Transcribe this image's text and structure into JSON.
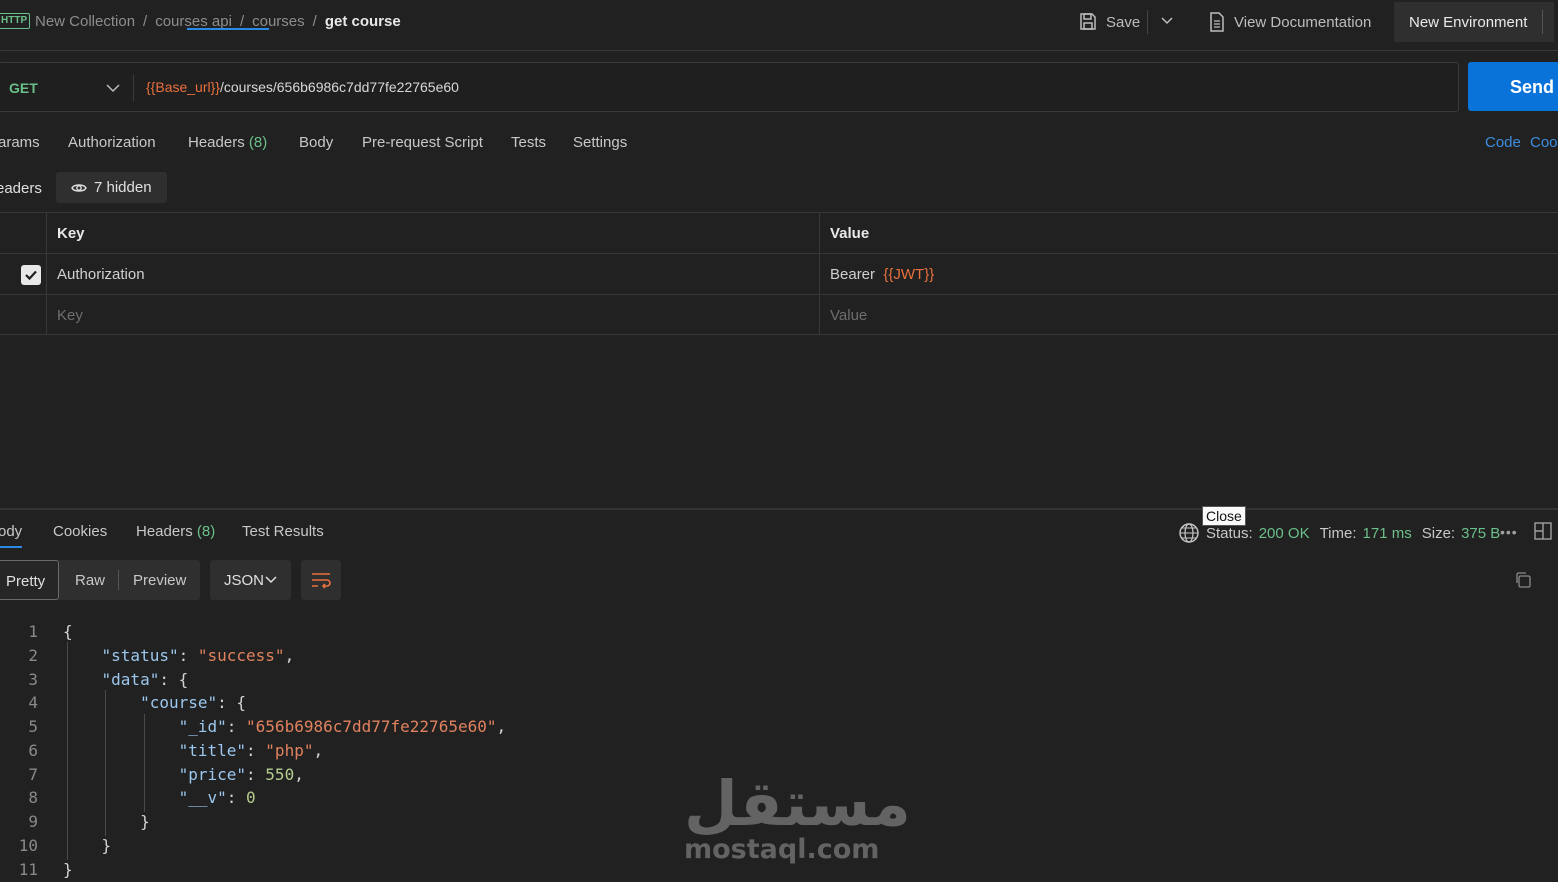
{
  "topbar": {
    "http_icon": "HTTP",
    "breadcrumbs": [
      "New Collection",
      "courses api",
      "courses"
    ],
    "current": "get course",
    "save_label": "Save",
    "view_doc_label": "View Documentation",
    "environment_label": "New Environment"
  },
  "request": {
    "method": "GET",
    "url_var": "{{Base_url}}",
    "url_path": "/courses/656b6986c7dd77fe22765e60",
    "send_label": "Send"
  },
  "request_tabs": {
    "params": "arams",
    "authorization": "Authorization",
    "headers": "Headers",
    "headers_count": "(8)",
    "body": "Body",
    "prerequest": "Pre-request Script",
    "tests": "Tests",
    "settings": "Settings",
    "code": "Code",
    "cookies_cut": "Coo"
  },
  "headers_section": {
    "label": "eaders",
    "hidden_label": "7 hidden"
  },
  "headers_table": {
    "col_key": "Key",
    "col_value": "Value",
    "rows": [
      {
        "key": "Authorization",
        "value_prefix": "Bearer",
        "value_var": "{{JWT}}",
        "checked": true
      }
    ],
    "key_placeholder": "Key",
    "value_placeholder": "Value"
  },
  "response_tabs": {
    "body": "ody",
    "cookies": "Cookies",
    "headers": "Headers",
    "headers_count": "(8)",
    "test_results": "Test Results"
  },
  "response_status": {
    "tooltip": "Close",
    "status_label": "Status:",
    "status_value": "200 OK",
    "time_label": "Time:",
    "time_value": "171 ms",
    "size_label": "Size:",
    "size_value": "375 B",
    "more": "•••"
  },
  "response_format": {
    "pretty": "Pretty",
    "raw": "Raw",
    "preview": "Preview",
    "json": "JSON"
  },
  "response_body": {
    "line_numbers": [
      "1",
      "2",
      "3",
      "4",
      "5",
      "6",
      "7",
      "8",
      "9",
      "10",
      "11"
    ],
    "status_key": "\"status\"",
    "status_val": "\"success\"",
    "data_key": "\"data\"",
    "course_key": "\"course\"",
    "id_key": "\"_id\"",
    "id_val": "\"656b6986c7dd77fe22765e60\"",
    "title_key": "\"title\"",
    "title_val": "\"php\"",
    "price_key": "\"price\"",
    "price_val": "550",
    "v_key": "\"__v\"",
    "v_val": "0"
  },
  "watermark": {
    "arabic": "مستقل",
    "latin": "mostaql.com"
  },
  "colors": {
    "accent_blue": "#0a73d9",
    "green": "#6bbf8a",
    "variable_orange": "#e8713d"
  }
}
